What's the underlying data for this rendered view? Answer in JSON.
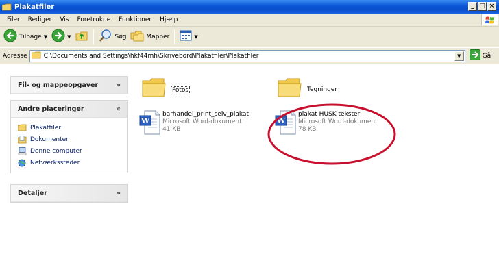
{
  "window": {
    "title": "Plakatfiler"
  },
  "menu": [
    "Filer",
    "Rediger",
    "Vis",
    "Foretrukne",
    "Funktioner",
    "Hjælp"
  ],
  "toolbar": {
    "back": "Tilbage",
    "search": "Søg",
    "folders": "Mapper"
  },
  "address": {
    "label": "Adresse",
    "path": "C:\\Documents and Settings\\hkf44mh\\Skrivebord\\Plakatfiler\\Plakatfiler",
    "go": "Gå"
  },
  "taskpane": {
    "file_tasks": {
      "title": "Fil- og mappeopgaver"
    },
    "other_places": {
      "title": "Andre placeringer",
      "links": [
        "Plakatfiler",
        "Dokumenter",
        "Denne computer",
        "Netværkssteder"
      ]
    },
    "details": {
      "title": "Detaljer"
    }
  },
  "files": {
    "folder1": "Fotos",
    "folder2": "Tegninger",
    "doc1": {
      "name": "barhandel_print_selv_plakat",
      "type": "Microsoft Word-dokument",
      "size": "41 KB"
    },
    "doc2": {
      "name": "plakat HUSK tekster",
      "type": "Microsoft Word-dokument",
      "size": "78 KB"
    }
  },
  "colors": {
    "title_blue": "#0a55d6",
    "highlight_red": "#c8102e"
  }
}
